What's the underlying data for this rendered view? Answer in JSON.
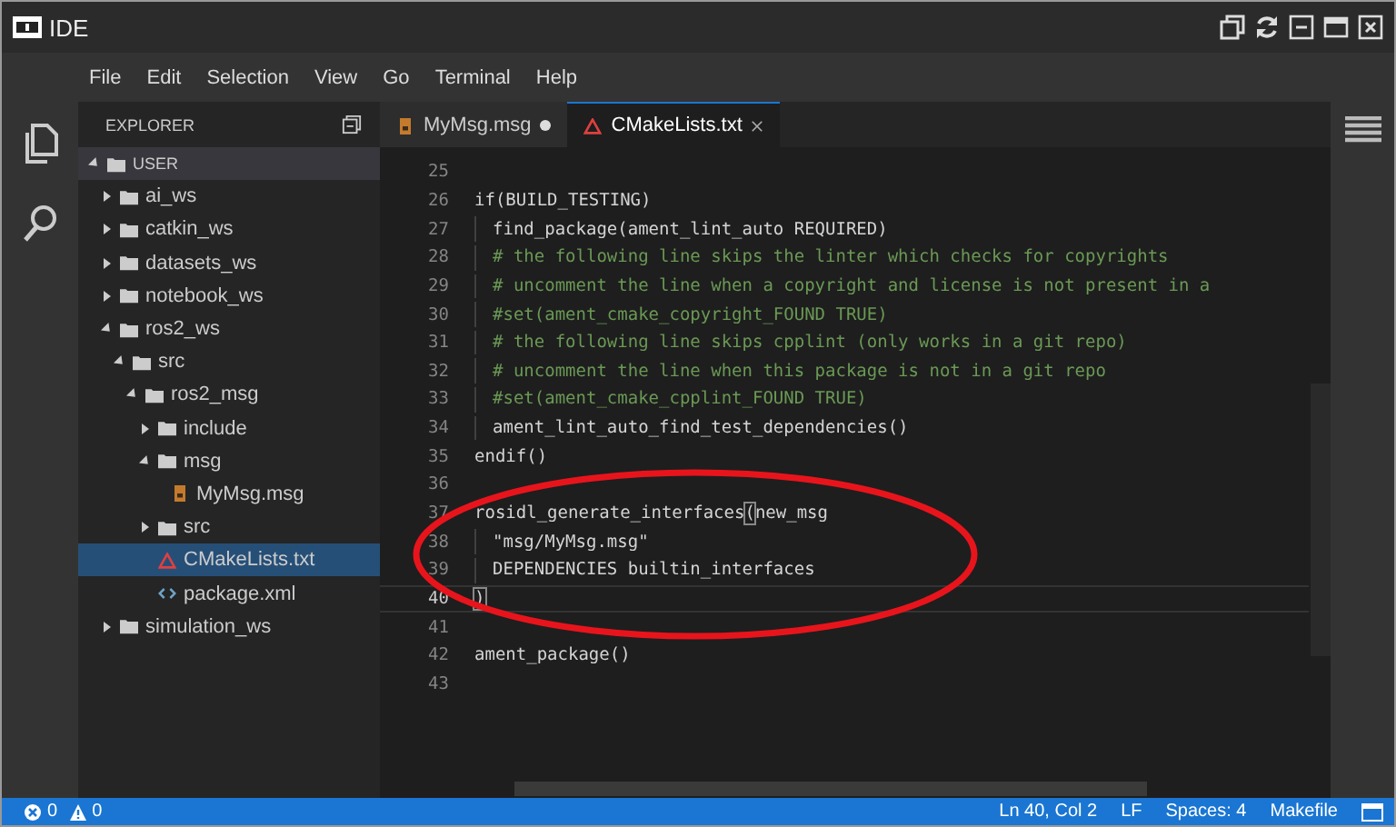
{
  "window": {
    "title": "IDE"
  },
  "menu": [
    "File",
    "Edit",
    "Selection",
    "View",
    "Go",
    "Terminal",
    "Help"
  ],
  "explorer": {
    "title": "EXPLORER",
    "root": {
      "label": "USER",
      "expanded": true,
      "children": [
        {
          "label": "ai_ws",
          "kind": "folder",
          "expanded": false,
          "selected": false
        },
        {
          "label": "catkin_ws",
          "kind": "folder",
          "expanded": false,
          "selected": false
        },
        {
          "label": "datasets_ws",
          "kind": "folder",
          "expanded": false,
          "selected": false
        },
        {
          "label": "notebook_ws",
          "kind": "folder",
          "expanded": false,
          "selected": false
        },
        {
          "label": "ros2_ws",
          "kind": "folder",
          "expanded": true,
          "selected": false,
          "children": [
            {
              "label": "src",
              "kind": "folder",
              "expanded": true,
              "selected": false,
              "children": [
                {
                  "label": "ros2_msg",
                  "kind": "folder",
                  "expanded": true,
                  "selected": false,
                  "children": [
                    {
                      "label": "include",
                      "kind": "folder",
                      "expanded": false,
                      "selected": false
                    },
                    {
                      "label": "msg",
                      "kind": "folder",
                      "expanded": true,
                      "selected": false,
                      "children": [
                        {
                          "label": "MyMsg.msg",
                          "kind": "msg",
                          "selected": false
                        }
                      ]
                    },
                    {
                      "label": "src",
                      "kind": "folder",
                      "expanded": false,
                      "selected": false
                    },
                    {
                      "label": "CMakeLists.txt",
                      "kind": "cmake",
                      "selected": true
                    },
                    {
                      "label": "package.xml",
                      "kind": "xml",
                      "selected": false
                    }
                  ]
                }
              ]
            }
          ]
        },
        {
          "label": "simulation_ws",
          "kind": "folder",
          "expanded": false,
          "selected": false
        }
      ]
    }
  },
  "tabs": [
    {
      "label": "MyMsg.msg",
      "kind": "msg",
      "selected": false,
      "modified": true
    },
    {
      "label": "CMakeLists.txt",
      "kind": "cmake",
      "selected": true,
      "modified": false
    }
  ],
  "code": [
    {
      "num": "25",
      "indent": false,
      "current": false
    },
    {
      "num": "26",
      "indent": false,
      "current": false,
      "parts": [
        {
          "text": "if(BUILD_TESTING)",
          "kind": "code"
        }
      ]
    },
    {
      "num": "27",
      "indent": true,
      "current": false,
      "parts": [
        {
          "text": "find_package(ament_lint_auto REQUIRED)",
          "kind": "code"
        }
      ]
    },
    {
      "num": "28",
      "indent": true,
      "current": false,
      "parts": [
        {
          "text": "# the following line skips the linter which checks for copyrights",
          "kind": "comment"
        }
      ]
    },
    {
      "num": "29",
      "indent": true,
      "current": false,
      "parts": [
        {
          "text": "# uncomment the line when a copyright and license is not present in a",
          "kind": "comment"
        }
      ]
    },
    {
      "num": "30",
      "indent": true,
      "current": false,
      "parts": [
        {
          "text": "#set(ament_cmake_copyright_FOUND TRUE)",
          "kind": "comment"
        }
      ]
    },
    {
      "num": "31",
      "indent": true,
      "current": false,
      "parts": [
        {
          "text": "# the following line skips cpplint (only works in a git repo)",
          "kind": "comment"
        }
      ]
    },
    {
      "num": "32",
      "indent": true,
      "current": false,
      "parts": [
        {
          "text": "# uncomment the line when this package is not in a git repo",
          "kind": "comment"
        }
      ]
    },
    {
      "num": "33",
      "indent": true,
      "current": false,
      "parts": [
        {
          "text": "#set(ament_cmake_cpplint_FOUND TRUE)",
          "kind": "comment"
        }
      ]
    },
    {
      "num": "34",
      "indent": true,
      "current": false,
      "parts": [
        {
          "text": "ament_lint_auto_find_test_dependencies()",
          "kind": "code"
        }
      ]
    },
    {
      "num": "35",
      "indent": false,
      "current": false,
      "parts": [
        {
          "text": "endif()",
          "kind": "code"
        }
      ]
    },
    {
      "num": "36",
      "indent": false,
      "current": false
    },
    {
      "num": "37",
      "indent": false,
      "current": false,
      "parts": [
        {
          "text": "rosidl_generate_interfaces",
          "kind": "code"
        },
        {
          "text": "(",
          "kind": "bracket"
        },
        {
          "text": "new_msg",
          "kind": "code"
        }
      ]
    },
    {
      "num": "38",
      "indent": true,
      "current": false,
      "parts": [
        {
          "text": "\"msg/MyMsg.msg\"",
          "kind": "code"
        }
      ]
    },
    {
      "num": "39",
      "indent": true,
      "current": false,
      "parts": [
        {
          "text": "DEPENDENCIES builtin_interfaces",
          "kind": "code"
        }
      ]
    },
    {
      "num": "40",
      "indent": false,
      "current": true,
      "parts": [
        {
          "text": ")",
          "kind": "bracket"
        }
      ]
    },
    {
      "num": "41",
      "indent": false,
      "current": false
    },
    {
      "num": "42",
      "indent": false,
      "current": false,
      "parts": [
        {
          "text": "ament_package()",
          "kind": "code"
        }
      ]
    },
    {
      "num": "43",
      "indent": false,
      "current": false
    }
  ],
  "status_bar": {
    "errors": "0",
    "warnings": "0",
    "items": [
      "Ln 40, Col 2",
      "LF",
      "Spaces: 4",
      "Makefile"
    ]
  }
}
